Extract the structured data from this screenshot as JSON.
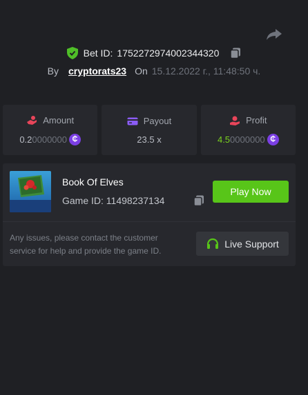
{
  "header": {
    "bet_id_label": "Bet ID:",
    "bet_id": "1752272974002344320",
    "by_label": "By",
    "username": "cryptorats23",
    "on_label": "On",
    "date": "15.12.2022 г., 11:48:50 ч."
  },
  "stats": {
    "amount_label": "Amount",
    "amount_value_main": "0.2",
    "amount_value_zeros": "0000000",
    "payout_label": "Payout",
    "payout_value": "23.5 x",
    "profit_label": "Profit",
    "profit_value_main": "4.5",
    "profit_value_zeros": "0000000",
    "currency_symbol": "₵"
  },
  "game": {
    "thumbnail_text": "BOOK OF ELVES",
    "title": "Book Of Elves",
    "id_label": "Game ID:",
    "id": "11498237134",
    "play_label": "Play Now"
  },
  "support": {
    "message": "Any issues, please contact the customer service for help and provide the game ID.",
    "button_label": "Live Support"
  },
  "icons": {
    "share": "share-icon",
    "verified": "shield-check-icon",
    "copy": "copy-icon",
    "amount": "coins-hand-icon",
    "payout": "card-icon",
    "profit": "hand-coin-icon",
    "coin": "coin-icon",
    "support": "headset-icon"
  },
  "colors": {
    "background": "#1f2024",
    "card": "#27282d",
    "accent_green": "#58c519",
    "profit_green": "#7ad11f",
    "coin_purple": "#7b3fe4",
    "payout_purple": "#8b5cf6",
    "icon_red": "#e8455a"
  }
}
